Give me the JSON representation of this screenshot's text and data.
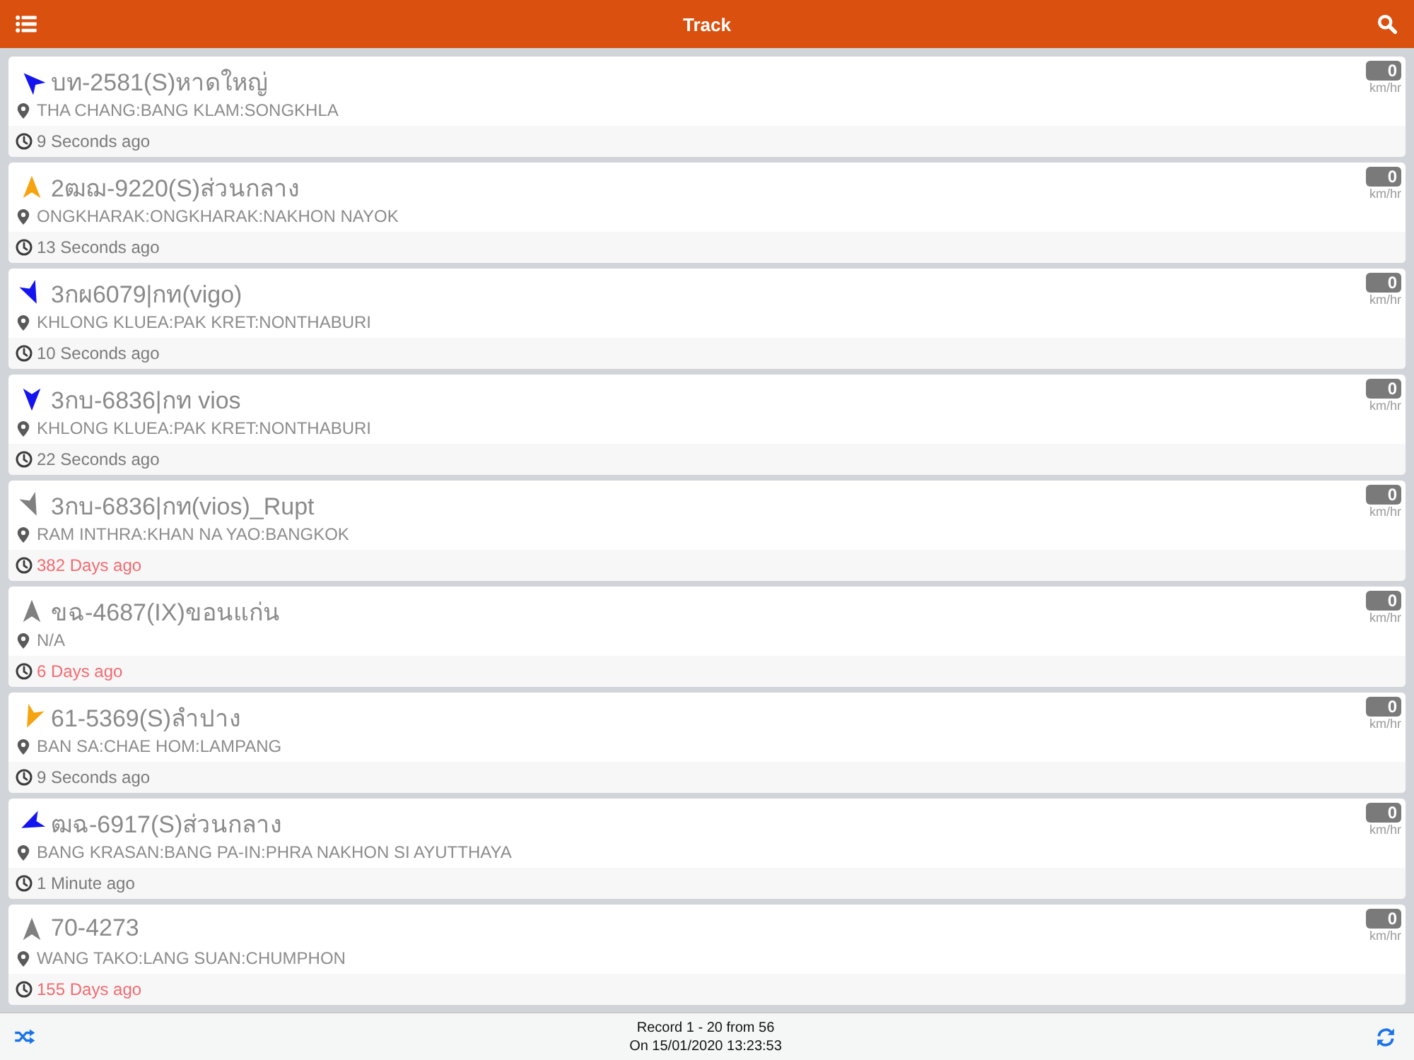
{
  "header": {
    "title": "Track"
  },
  "vehicles": [
    {
      "name": "บท-2581(S)หาดใหญ่",
      "kind": "nw",
      "color": "#1414f0",
      "location": "THA CHANG:BANG KLAM:SONGKHLA",
      "speed": "0",
      "unit": "km/hr",
      "updated": "9 Seconds ago",
      "stale": false
    },
    {
      "name": "2ฒฌ-9220(S)ส่วนกลาง",
      "kind": "n",
      "color": "#f5a30f",
      "location": "ONGKHARAK:ONGKHARAK:NAKHON NAYOK",
      "speed": "0",
      "unit": "km/hr",
      "updated": "13 Seconds ago",
      "stale": false
    },
    {
      "name": "3กผ6079|กท(vigo)",
      "kind": "sse",
      "color": "#1414f0",
      "location": "KHLONG KLUEA:PAK KRET:NONTHABURI",
      "speed": "0",
      "unit": "km/hr",
      "updated": "10 Seconds ago",
      "stale": false
    },
    {
      "name": "3กบ-6836|กท vios",
      "kind": "s",
      "color": "#1414f0",
      "location": "KHLONG KLUEA:PAK KRET:NONTHABURI",
      "speed": "0",
      "unit": "km/hr",
      "updated": "22 Seconds ago",
      "stale": false
    },
    {
      "name": "3กบ-6836|กท(vios)_Rupt",
      "kind": "sse",
      "color": "#808080",
      "location": "RAM INTHRA:KHAN NA YAO:BANGKOK",
      "speed": "0",
      "unit": "km/hr",
      "updated": "382 Days ago",
      "stale": true
    },
    {
      "name": "ขฉ-4687(IX)ขอนแก่น",
      "kind": "n",
      "color": "#808080",
      "location": "N/A",
      "speed": "0",
      "unit": "km/hr",
      "updated": "6 Days ago",
      "stale": true
    },
    {
      "name": "61-5369(S)ลำปาง",
      "kind": "ssw",
      "color": "#f5a30f",
      "location": "BAN SA:CHAE HOM:LAMPANG",
      "speed": "0",
      "unit": "km/hr",
      "updated": "9 Seconds ago",
      "stale": false
    },
    {
      "name": "ฒฉ-6917(S)ส่วนกลาง",
      "kind": "wsw",
      "color": "#1414f0",
      "location": "BANG KRASAN:BANG PA-IN:PHRA NAKHON SI AYUTTHAYA",
      "speed": "0",
      "unit": "km/hr",
      "updated": "1 Minute ago",
      "stale": false
    },
    {
      "name": "70-4273",
      "kind": "n",
      "color": "#808080",
      "location": "WANG TAKO:LANG SUAN:CHUMPHON",
      "speed": "0",
      "unit": "km/hr",
      "updated": "155 Days ago",
      "stale": true
    }
  ],
  "footer": {
    "record": "Record 1 - 20 from 56",
    "timestamp": "On 15/01/2020 13:23:53"
  }
}
